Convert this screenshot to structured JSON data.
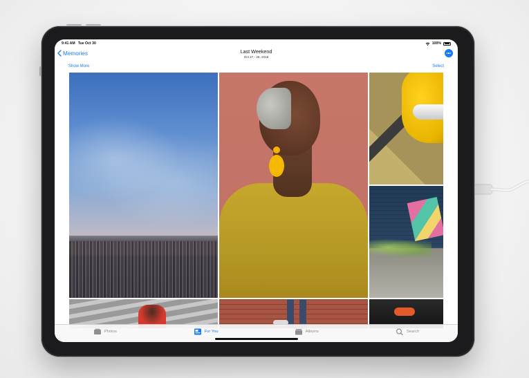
{
  "status_bar": {
    "time": "9:41 AM",
    "date": "Tue Oct 30",
    "battery": "100%"
  },
  "nav": {
    "back_label": "Memories",
    "title": "Last Weekend",
    "subtitle": "Oct 27 - 28, 2018"
  },
  "subbar": {
    "show_more": "Show More",
    "select": "Select"
  },
  "tabs": [
    {
      "label": "Photos",
      "icon": "photos-icon",
      "active": false
    },
    {
      "label": "For You",
      "icon": "for-you-icon",
      "active": true
    },
    {
      "label": "Albums",
      "icon": "albums-icon",
      "active": false
    },
    {
      "label": "Search",
      "icon": "search-icon",
      "active": false
    }
  ],
  "colors": {
    "accent": "#1a7cf4",
    "inactive": "#8e8e93"
  }
}
